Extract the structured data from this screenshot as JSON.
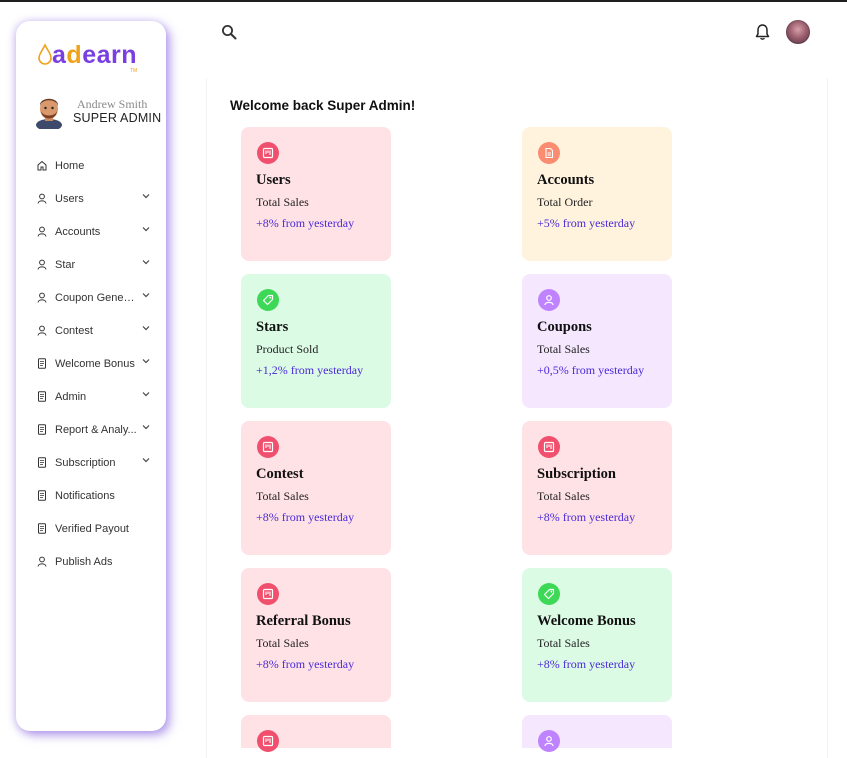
{
  "app": {
    "logo_text_a": "a",
    "logo_text_accent": "d",
    "logo_text_rest": "earn",
    "logo_tm": "TM",
    "brand_color": "#7a3fe0",
    "accent_color": "#f0a21b"
  },
  "profile": {
    "name": "Andrew Smith",
    "role": "SUPER ADMIN"
  },
  "sidebar": {
    "items": [
      {
        "label": "Home",
        "icon": "home-icon",
        "has_dropdown": false
      },
      {
        "label": "Users",
        "icon": "user-icon",
        "has_dropdown": true
      },
      {
        "label": "Accounts",
        "icon": "user-icon",
        "has_dropdown": true
      },
      {
        "label": "Star",
        "icon": "user-icon",
        "has_dropdown": true
      },
      {
        "label": "Coupon Genera...",
        "icon": "user-icon",
        "has_dropdown": true
      },
      {
        "label": "Contest",
        "icon": "user-icon",
        "has_dropdown": true
      },
      {
        "label": "Welcome Bonus",
        "icon": "document-icon",
        "has_dropdown": true
      },
      {
        "label": "Admin",
        "icon": "document-icon",
        "has_dropdown": true
      },
      {
        "label": "Report & Analy...",
        "icon": "document-icon",
        "has_dropdown": true
      },
      {
        "label": "Subscription",
        "icon": "document-icon",
        "has_dropdown": true
      },
      {
        "label": "Notifications",
        "icon": "document-icon",
        "has_dropdown": false
      },
      {
        "label": "Verified Payout",
        "icon": "document-icon",
        "has_dropdown": false
      },
      {
        "label": "Publish Ads",
        "icon": "user-icon",
        "has_dropdown": false
      }
    ]
  },
  "header": {
    "search_icon": "search-icon",
    "notification_icon": "bell-icon"
  },
  "main": {
    "welcome": "Welcome back Super Admin!",
    "cards": [
      {
        "title": "Users",
        "subtitle": "Total Sales",
        "change": "+8% from yesterday",
        "theme": "pink",
        "icon": "board-icon"
      },
      {
        "title": "Accounts",
        "subtitle": "Total Order",
        "change": "+5% from yesterday",
        "theme": "yellow",
        "icon": "document-icon"
      },
      {
        "title": "Stars",
        "subtitle": "Product Sold",
        "change": "+1,2% from yesterday",
        "theme": "green",
        "icon": "tag-icon"
      },
      {
        "title": "Coupons",
        "subtitle": "Total Sales",
        "change": "+0,5% from yesterday",
        "theme": "purple",
        "icon": "user-icon"
      },
      {
        "title": "Contest",
        "subtitle": "Total Sales",
        "change": "+8% from yesterday",
        "theme": "pink",
        "icon": "board-icon"
      },
      {
        "title": "Subscription",
        "subtitle": "Total Sales",
        "change": "+8% from yesterday",
        "theme": "pink",
        "icon": "board-icon"
      },
      {
        "title": "Referral Bonus",
        "subtitle": "Total Sales",
        "change": "+8% from yesterday",
        "theme": "pink",
        "icon": "board-icon"
      },
      {
        "title": "Welcome Bonus",
        "subtitle": "Total Sales",
        "change": "+8% from yesterday",
        "theme": "green",
        "icon": "tag-icon"
      },
      {
        "title": "",
        "subtitle": "",
        "change": "",
        "theme": "pink",
        "icon": "board-icon"
      },
      {
        "title": "",
        "subtitle": "",
        "change": "",
        "theme": "purple",
        "icon": "user-icon"
      }
    ]
  }
}
